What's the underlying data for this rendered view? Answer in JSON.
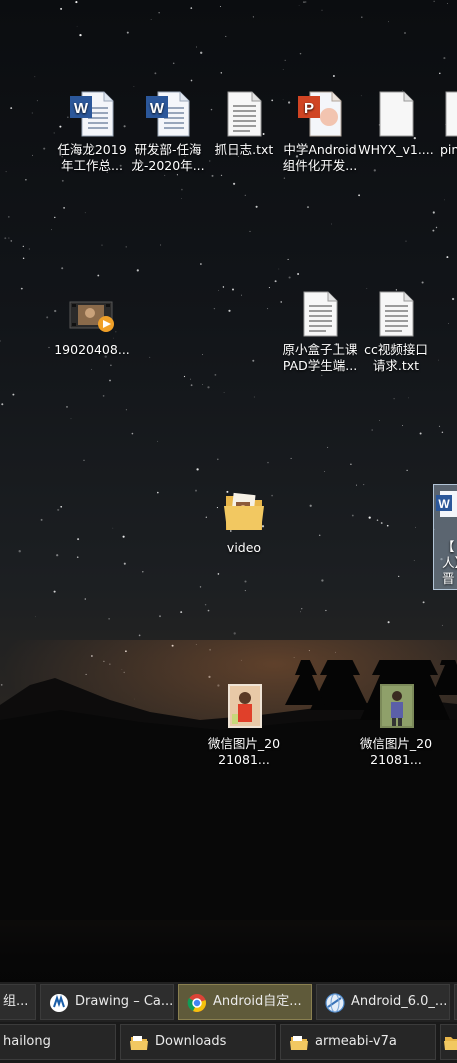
{
  "desktop": {
    "icons": [
      {
        "label": "任海龙2019年工作总...",
        "type": "word"
      },
      {
        "label": "研发部-任海龙-2020年...",
        "type": "word"
      },
      {
        "label": "抓日志.txt",
        "type": "text"
      },
      {
        "label": "中学Android组件化开发...",
        "type": "ppt"
      },
      {
        "label": "WHYX_v1....",
        "type": "blank"
      },
      {
        "label": "pin",
        "type": "blank"
      },
      {
        "label": "19020408...",
        "type": "video"
      },
      {
        "label": "原小盒子上课PAD学生端...",
        "type": "text"
      },
      {
        "label": "cc视频接口请求.txt",
        "type": "text"
      },
      {
        "label": "video",
        "type": "folder"
      },
      {
        "label": "【\n人】\n晋",
        "type": "word"
      },
      {
        "label": "微信图片_2021081...",
        "type": "photo"
      },
      {
        "label": "微信图片_2021081...",
        "type": "photo"
      }
    ]
  },
  "taskbar": {
    "row1": [
      {
        "label": "组...",
        "icon": "none"
      },
      {
        "label": "Drawing – Ca...",
        "icon": "drawing-app-icon"
      },
      {
        "label": "Android自定...",
        "icon": "chrome-icon",
        "active": true
      },
      {
        "label": "Android_6.0_...",
        "icon": "globe-icon"
      },
      {
        "label": "",
        "icon": "none"
      }
    ],
    "row2": [
      {
        "label": "hailong",
        "icon": "none"
      },
      {
        "label": "Downloads",
        "icon": "folder-icon"
      },
      {
        "label": "armeabi-v7a",
        "icon": "folder-icon"
      },
      {
        "label": "",
        "icon": "folder-icon"
      }
    ]
  },
  "colors": {
    "word_blue": "#2b579a",
    "ppt_orange": "#d04423",
    "folder_yellow": "#e8b64a",
    "taskbar_active": "#5f5a3a"
  }
}
